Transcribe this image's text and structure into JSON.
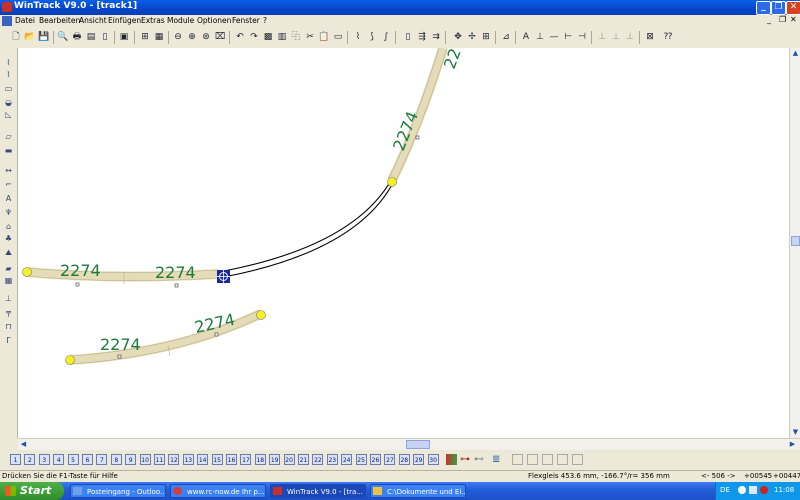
{
  "window": {
    "title": "WinTrack  V9.0 - [track1]"
  },
  "menu": [
    "Datei",
    "Bearbeiten",
    "Ansicht",
    "Einfügen",
    "Extras",
    "Module",
    "Optionen",
    "Fenster",
    "?"
  ],
  "canvas": {
    "track_label": "2274"
  },
  "modules": [
    "1",
    "2",
    "3",
    "4",
    "5",
    "6",
    "7",
    "8",
    "9",
    "10",
    "11",
    "12",
    "13",
    "14",
    "15",
    "16",
    "17",
    "18",
    "19",
    "20",
    "21",
    "22",
    "23",
    "24",
    "25",
    "26",
    "27",
    "28",
    "29",
    "30"
  ],
  "status": {
    "hint": "Drücken Sie die  F1-Taste für Hilfe",
    "flex": "Flexgleis 453.6 mm, -166.7°/r= 356 mm",
    "nav": "<- 506 ->",
    "coord_x": "+00545",
    "coord_y": "+00447"
  },
  "taskbar": {
    "start": "Start",
    "tasks": [
      "Posteingang - Outloo...",
      "www.rc-now.de Ihr p...",
      "WinTrack  V9.0 - [tra...",
      "C:\\Dokumente und Ei..."
    ],
    "lang": "DE",
    "clock": "11:08"
  }
}
